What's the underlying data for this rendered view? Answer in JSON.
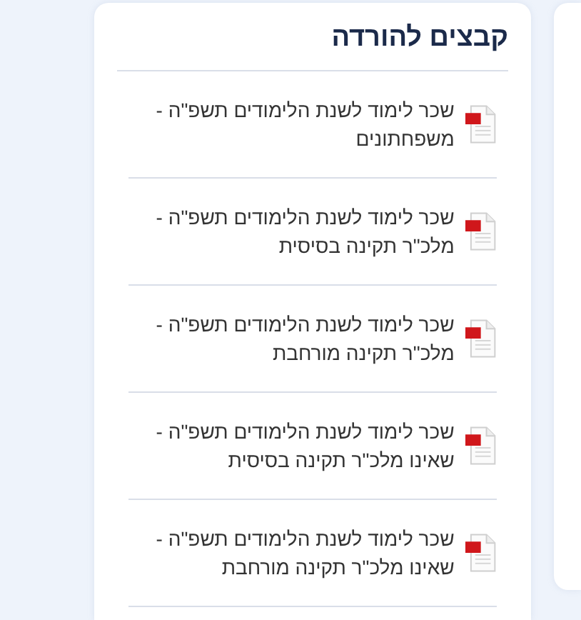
{
  "title": "קבצים להורדה",
  "files": [
    {
      "name": "שכר לימוד לשנת הלימודים תשפ\"ה - משפחתונים"
    },
    {
      "name": "שכר לימוד לשנת הלימודים תשפ\"ה - מלכ\"ר תקינה בסיסית"
    },
    {
      "name": "שכר לימוד לשנת הלימודים תשפ\"ה - מלכ\"ר תקינה מורחבת"
    },
    {
      "name": "שכר לימוד לשנת הלימודים תשפ\"ה - שאינו מלכ\"ר תקינה בסיסית"
    },
    {
      "name": "שכר לימוד לשנת הלימודים תשפ\"ה - שאינו מלכ\"ר תקינה מורחבת"
    }
  ]
}
